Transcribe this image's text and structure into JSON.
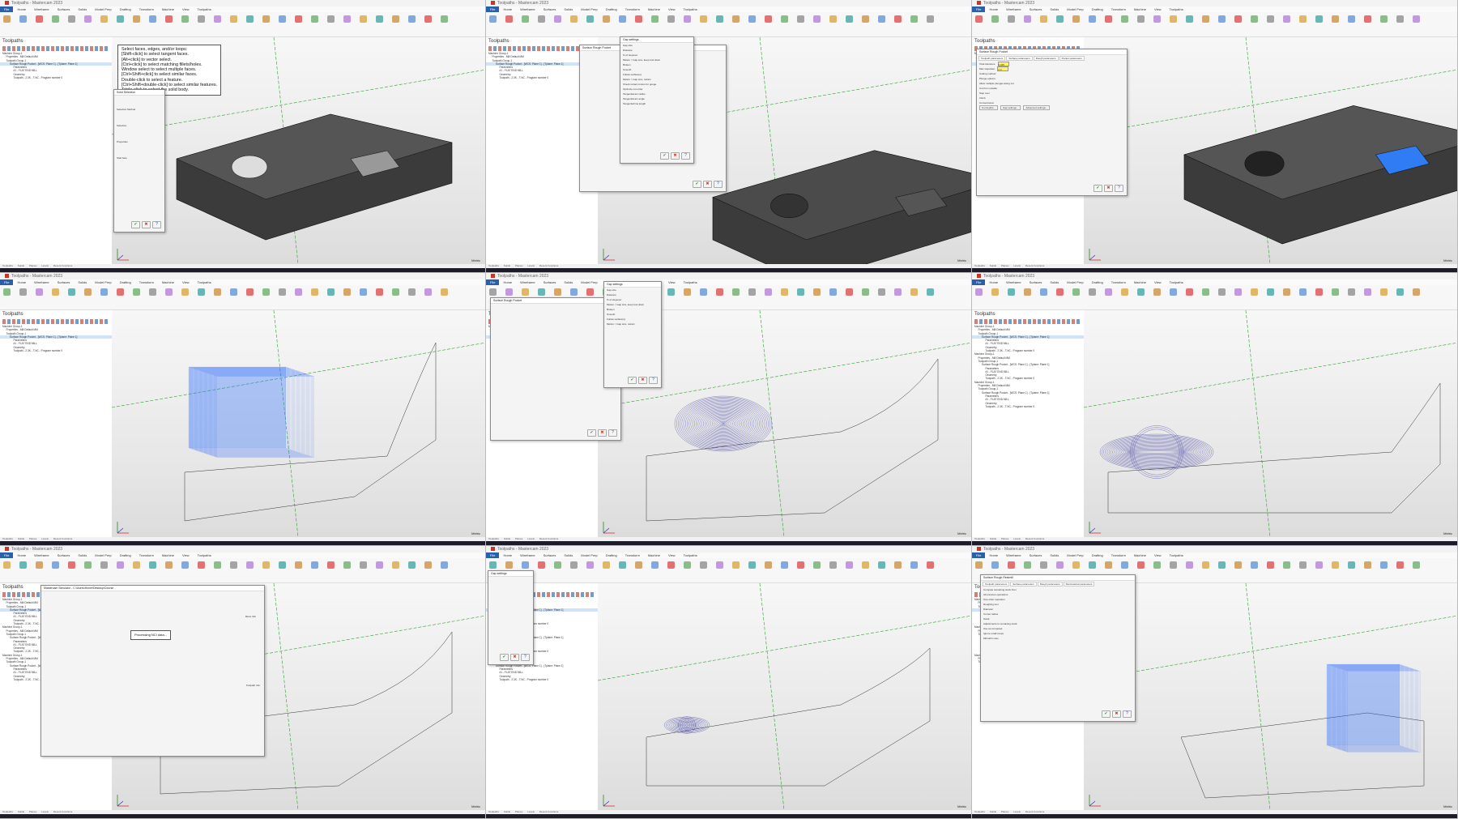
{
  "app": {
    "window_title": "Toolpaths - Mastercam 2023",
    "file_button": "File",
    "ribbon_tabs": [
      "Home",
      "Wireframe",
      "Surfaces",
      "Solids",
      "Model Prep",
      "Drafting",
      "Transform",
      "Machine",
      "View",
      "Toolpaths"
    ],
    "toolpaths_panel_title": "Toolpaths",
    "status_items": [
      "Toolpaths",
      "Solids",
      "Planes",
      "Levels",
      "Recent Functions"
    ],
    "view_scale_lines": [
      "Metric"
    ]
  },
  "tree": {
    "lines": [
      "Machine Group-1",
      "Properties - Mill Default MM",
      "Toolpath Group-1",
      "Surface Rough Pocket - [WCS: Plane 1] - [Tplane: Plane 1]",
      "Parameters",
      "#1 - FLAT END MILL",
      "Geometry",
      "Toolpath - 2.3K - T.NC - Program number 0"
    ]
  },
  "tooltip": {
    "lines": [
      "Select faces, edges, and/or loops:",
      "[Shift-click] to select tangent faces.",
      "[Alt+click] to vector select.",
      "[Ctrl+click] to select matching fillets/holes.",
      "Window select to select multiple faces.",
      "[Ctrl+Shift+click] to select similar faces.",
      "Double-click to select a feature.",
      "[Ctrl+Shift+double-click] to select similar features.",
      "Triple-click to select the solid body."
    ]
  },
  "dialogs": {
    "gap_settings": {
      "title": "Gap settings",
      "rows": [
        "Gap size",
        "Distance",
        "% of stepover",
        "Motion < Gap size, keep tool down",
        "Broken",
        "Smooth",
        "Follow surface(s)",
        "Motion > Gap size, retract",
        "Check retract motion for gouge",
        "Optimize cut order",
        "Tangential arc radius",
        "Tangential arc angle",
        "Tangential line length"
      ],
      "percent_value": "100.0",
      "arc_radius": "0.0",
      "arc_angle": "90.0",
      "line_length": "0.0",
      "reset_label": "Reset"
    },
    "surface_rough_pocket": {
      "title": "Surface Rough Pocket",
      "tabs": [
        "Toolpath parameters",
        "Surface parameters",
        "Rough parameters",
        "Pocket parameters"
      ],
      "rows": [
        "Total tolerance",
        "Max stepdown",
        "Cutting method",
        "Plunge options",
        "Allow multiple plunges along cut",
        "Cut from outside",
        "Step over",
        "Climb",
        "Conventional"
      ],
      "buttons": [
        "Cut depths...",
        "Gap settings...",
        "Advanced settings..."
      ],
      "total_tolerance": "0.025",
      "max_stepdown": "2.0",
      "footer_label": "Generate toolpath"
    },
    "rest_roughing": {
      "title": "Surface Rough Restmill",
      "tabs": [
        "Toolpath parameters",
        "Surface parameters",
        "Rough parameters",
        "Restmaterial parameters"
      ],
      "rows": [
        "Compute remaining stock from",
        "All previous operations",
        "One other operation",
        "Roughing tool",
        "Diameter",
        "Corner radius",
        "Stock",
        "Adjustments to remaining stock",
        "Use as computed",
        "Ignore small cusps",
        "Mill with Lines"
      ],
      "footer_label": "Generate toolpath"
    },
    "sim": {
      "title": "Mastercam Simulator - C:\\Users\\Home\\Desktop\\Course",
      "processing_text": "Processing NCI data...",
      "move_info_title": "Move Info",
      "toolpath_info_title": "Toolpath Info"
    }
  },
  "toolbox": {
    "title": "Solid Selection",
    "sections": [
      "Selection Method",
      "Selection",
      "Properties",
      "Start face"
    ]
  }
}
